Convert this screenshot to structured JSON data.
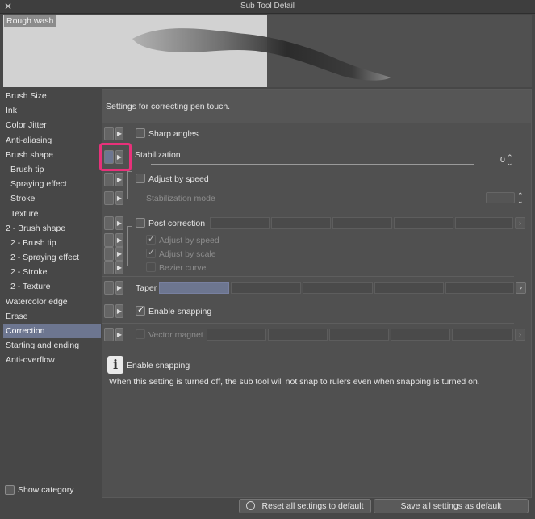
{
  "window": {
    "title": "Sub Tool Detail",
    "close_glyph": "✕"
  },
  "preview": {
    "tool_name": "Rough wash"
  },
  "sidebar": {
    "items": [
      {
        "label": "Brush Size",
        "sub": false
      },
      {
        "label": "Ink",
        "sub": false
      },
      {
        "label": "Color Jitter",
        "sub": false
      },
      {
        "label": "Anti-aliasing",
        "sub": false
      },
      {
        "label": "Brush shape",
        "sub": false
      },
      {
        "label": "Brush tip",
        "sub": true
      },
      {
        "label": "Spraying effect",
        "sub": true
      },
      {
        "label": "Stroke",
        "sub": true
      },
      {
        "label": "Texture",
        "sub": true
      },
      {
        "label": "2 - Brush shape",
        "sub": false
      },
      {
        "label": "2 - Brush tip",
        "sub": true
      },
      {
        "label": "2 - Spraying effect",
        "sub": true
      },
      {
        "label": "2 - Stroke",
        "sub": true
      },
      {
        "label": "2 - Texture",
        "sub": true
      },
      {
        "label": "Watercolor edge",
        "sub": false
      },
      {
        "label": "Erase",
        "sub": false
      },
      {
        "label": "Correction",
        "sub": false,
        "active": true
      },
      {
        "label": "Starting and ending",
        "sub": false
      },
      {
        "label": "Anti-overflow",
        "sub": false
      }
    ],
    "show_category": "Show category"
  },
  "panel": {
    "description": "Settings for correcting pen touch.",
    "sharp_angles": "Sharp angles",
    "stabilization": "Stabilization",
    "stabilization_value": "0",
    "adjust_by_speed": "Adjust by speed",
    "stabilization_mode": "Stabilization mode",
    "post_correction": "Post correction",
    "post_adjust_by_speed": "Adjust by speed",
    "post_adjust_by_scale": "Adjust by scale",
    "bezier_curve": "Bezier curve",
    "taper": "Taper",
    "enable_snapping": "Enable snapping",
    "vector_magnet": "Vector magnet"
  },
  "help": {
    "icon": "i",
    "title": "Enable snapping",
    "body": "When this setting is turned off, the sub tool will not snap to rulers even when snapping is turned on."
  },
  "buttons": {
    "reset": "Reset all settings to default",
    "save": "Save all settings as default"
  },
  "colors": {
    "accent": "#6d7690",
    "highlight": "#e8317a",
    "background": "#474747"
  }
}
